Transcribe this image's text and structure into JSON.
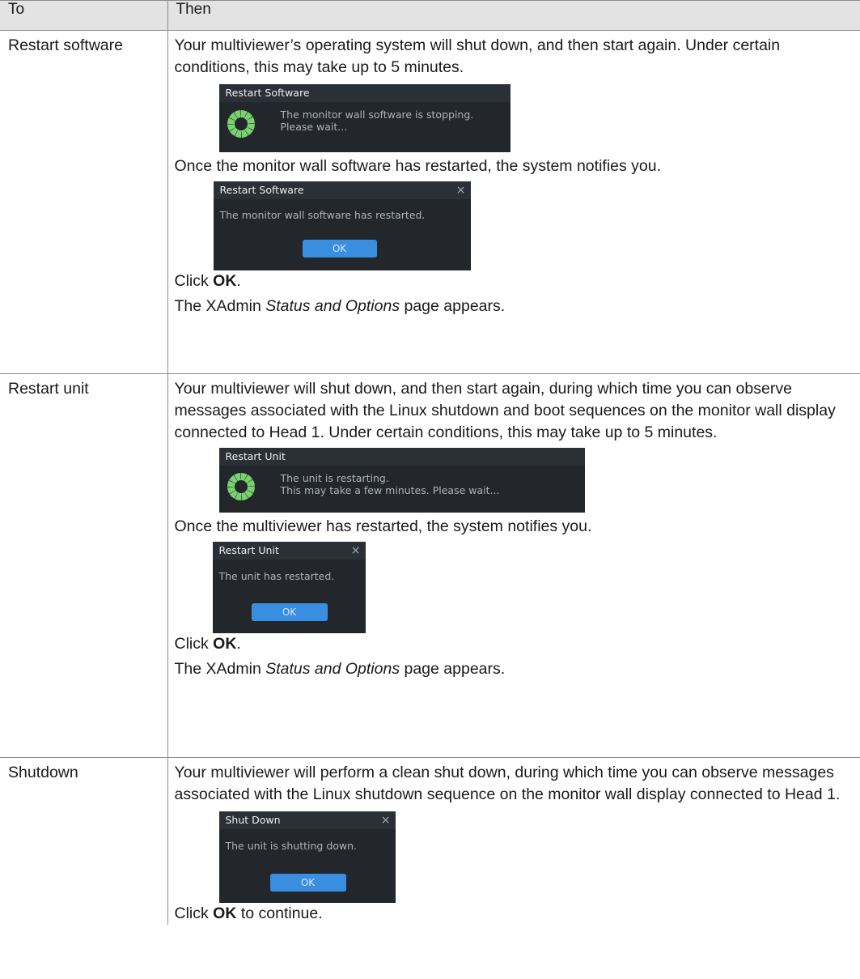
{
  "header": {
    "col1": "To",
    "col2": "Then"
  },
  "rows": [
    {
      "to": "Restart software",
      "p1": "Your multiviewer’s operating system will shut down, and then start again. Under certain conditions, this may take up to 5 minutes.",
      "dialog1": {
        "title": "Restart Software",
        "line1": "The monitor wall software is stopping.",
        "line2": "Please wait..."
      },
      "p2": "Once the monitor wall software has restarted, the system notifies you.",
      "dialog2": {
        "title": "Restart Software",
        "message": "The monitor wall software has restarted.",
        "ok": "OK",
        "close": "×"
      },
      "click_pre": "Click ",
      "click_bold": "OK",
      "click_post": ".",
      "status_pre": "The XAdmin ",
      "status_italic": "Status and Options",
      "status_post": " page appears."
    },
    {
      "to": "Restart unit",
      "p1": "Your multiviewer will shut down, and then start again, during which time you can observe messages associated with the Linux shutdown and boot sequences on the monitor wall display connected to Head 1. Under certain conditions, this may take up to 5 minutes.",
      "dialog1": {
        "title": "Restart Unit",
        "line1": "The unit is restarting.",
        "line2": "This may take a few minutes. Please wait..."
      },
      "p2": "Once the multiviewer has restarted, the system notifies you.",
      "dialog2": {
        "title": "Restart Unit",
        "message": "The unit has restarted.",
        "ok": "OK",
        "close": "×"
      },
      "click_pre": "Click ",
      "click_bold": "OK",
      "click_post": ".",
      "status_pre": "The XAdmin ",
      "status_italic": "Status and Options",
      "status_post": " page appears."
    },
    {
      "to": "Shutdown",
      "p1": "Your multiviewer will perform a clean shut down, during which time you can observe messages associated with the Linux shutdown sequence on the monitor wall display connected to Head 1.",
      "dialog2": {
        "title": "Shut Down",
        "message": "The unit is shutting down.",
        "ok": "OK",
        "close": "×"
      },
      "click_pre": "Click ",
      "click_bold": "OK",
      "click_post": " to continue."
    }
  ]
}
